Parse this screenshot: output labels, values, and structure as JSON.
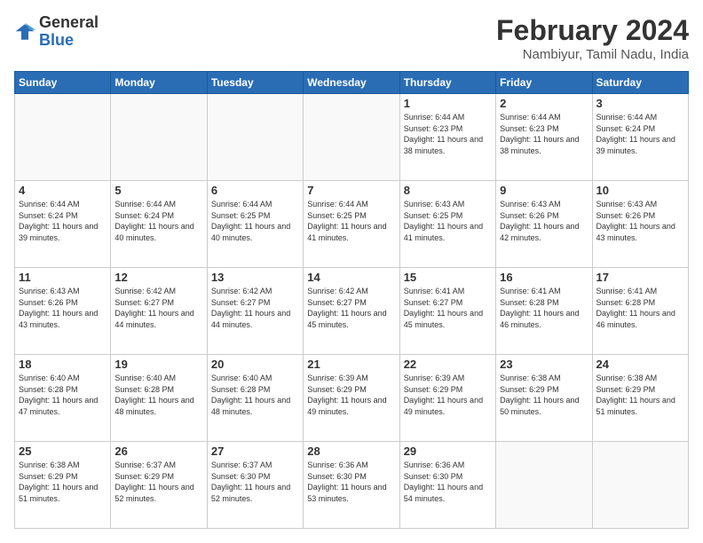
{
  "logo": {
    "general": "General",
    "blue": "Blue"
  },
  "title": "February 2024",
  "subtitle": "Nambiyur, Tamil Nadu, India",
  "weekdays": [
    "Sunday",
    "Monday",
    "Tuesday",
    "Wednesday",
    "Thursday",
    "Friday",
    "Saturday"
  ],
  "weeks": [
    [
      {
        "day": "",
        "info": ""
      },
      {
        "day": "",
        "info": ""
      },
      {
        "day": "",
        "info": ""
      },
      {
        "day": "",
        "info": ""
      },
      {
        "day": "1",
        "info": "Sunrise: 6:44 AM\nSunset: 6:23 PM\nDaylight: 11 hours and 38 minutes."
      },
      {
        "day": "2",
        "info": "Sunrise: 6:44 AM\nSunset: 6:23 PM\nDaylight: 11 hours and 38 minutes."
      },
      {
        "day": "3",
        "info": "Sunrise: 6:44 AM\nSunset: 6:24 PM\nDaylight: 11 hours and 39 minutes."
      }
    ],
    [
      {
        "day": "4",
        "info": "Sunrise: 6:44 AM\nSunset: 6:24 PM\nDaylight: 11 hours and 39 minutes."
      },
      {
        "day": "5",
        "info": "Sunrise: 6:44 AM\nSunset: 6:24 PM\nDaylight: 11 hours and 40 minutes."
      },
      {
        "day": "6",
        "info": "Sunrise: 6:44 AM\nSunset: 6:25 PM\nDaylight: 11 hours and 40 minutes."
      },
      {
        "day": "7",
        "info": "Sunrise: 6:44 AM\nSunset: 6:25 PM\nDaylight: 11 hours and 41 minutes."
      },
      {
        "day": "8",
        "info": "Sunrise: 6:43 AM\nSunset: 6:25 PM\nDaylight: 11 hours and 41 minutes."
      },
      {
        "day": "9",
        "info": "Sunrise: 6:43 AM\nSunset: 6:26 PM\nDaylight: 11 hours and 42 minutes."
      },
      {
        "day": "10",
        "info": "Sunrise: 6:43 AM\nSunset: 6:26 PM\nDaylight: 11 hours and 43 minutes."
      }
    ],
    [
      {
        "day": "11",
        "info": "Sunrise: 6:43 AM\nSunset: 6:26 PM\nDaylight: 11 hours and 43 minutes."
      },
      {
        "day": "12",
        "info": "Sunrise: 6:42 AM\nSunset: 6:27 PM\nDaylight: 11 hours and 44 minutes."
      },
      {
        "day": "13",
        "info": "Sunrise: 6:42 AM\nSunset: 6:27 PM\nDaylight: 11 hours and 44 minutes."
      },
      {
        "day": "14",
        "info": "Sunrise: 6:42 AM\nSunset: 6:27 PM\nDaylight: 11 hours and 45 minutes."
      },
      {
        "day": "15",
        "info": "Sunrise: 6:41 AM\nSunset: 6:27 PM\nDaylight: 11 hours and 45 minutes."
      },
      {
        "day": "16",
        "info": "Sunrise: 6:41 AM\nSunset: 6:28 PM\nDaylight: 11 hours and 46 minutes."
      },
      {
        "day": "17",
        "info": "Sunrise: 6:41 AM\nSunset: 6:28 PM\nDaylight: 11 hours and 46 minutes."
      }
    ],
    [
      {
        "day": "18",
        "info": "Sunrise: 6:40 AM\nSunset: 6:28 PM\nDaylight: 11 hours and 47 minutes."
      },
      {
        "day": "19",
        "info": "Sunrise: 6:40 AM\nSunset: 6:28 PM\nDaylight: 11 hours and 48 minutes."
      },
      {
        "day": "20",
        "info": "Sunrise: 6:40 AM\nSunset: 6:28 PM\nDaylight: 11 hours and 48 minutes."
      },
      {
        "day": "21",
        "info": "Sunrise: 6:39 AM\nSunset: 6:29 PM\nDaylight: 11 hours and 49 minutes."
      },
      {
        "day": "22",
        "info": "Sunrise: 6:39 AM\nSunset: 6:29 PM\nDaylight: 11 hours and 49 minutes."
      },
      {
        "day": "23",
        "info": "Sunrise: 6:38 AM\nSunset: 6:29 PM\nDaylight: 11 hours and 50 minutes."
      },
      {
        "day": "24",
        "info": "Sunrise: 6:38 AM\nSunset: 6:29 PM\nDaylight: 11 hours and 51 minutes."
      }
    ],
    [
      {
        "day": "25",
        "info": "Sunrise: 6:38 AM\nSunset: 6:29 PM\nDaylight: 11 hours and 51 minutes."
      },
      {
        "day": "26",
        "info": "Sunrise: 6:37 AM\nSunset: 6:29 PM\nDaylight: 11 hours and 52 minutes."
      },
      {
        "day": "27",
        "info": "Sunrise: 6:37 AM\nSunset: 6:30 PM\nDaylight: 11 hours and 52 minutes."
      },
      {
        "day": "28",
        "info": "Sunrise: 6:36 AM\nSunset: 6:30 PM\nDaylight: 11 hours and 53 minutes."
      },
      {
        "day": "29",
        "info": "Sunrise: 6:36 AM\nSunset: 6:30 PM\nDaylight: 11 hours and 54 minutes."
      },
      {
        "day": "",
        "info": ""
      },
      {
        "day": "",
        "info": ""
      }
    ]
  ]
}
